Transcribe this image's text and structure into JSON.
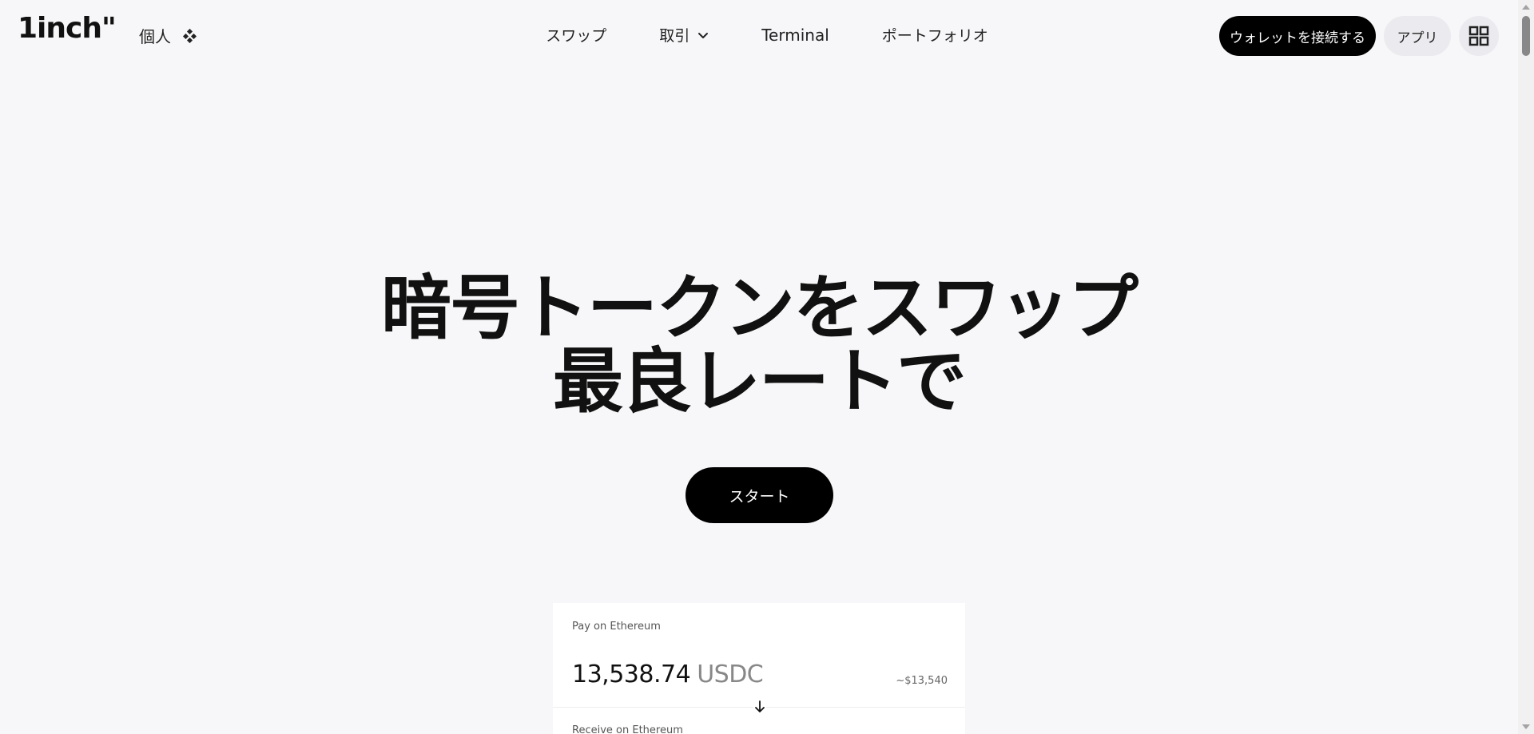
{
  "header": {
    "logo": "1inch\"",
    "mode_label": "個人",
    "nav": {
      "swap": "スワップ",
      "trade": "取引",
      "terminal": "Terminal",
      "portfolio": "ポートフォリオ"
    },
    "connect_wallet": "ウォレットを接続する",
    "app_button": "アプリ"
  },
  "hero": {
    "title_line1": "暗号トークンをスワップ",
    "title_line2": "最良レートで",
    "start_button": "スタート"
  },
  "swap_card": {
    "pay_label": "Pay on Ethereum",
    "pay_amount": "13,538.74",
    "pay_token": "USDC",
    "pay_usd": "~$13,540",
    "receive_label": "Receive on Ethereum"
  }
}
